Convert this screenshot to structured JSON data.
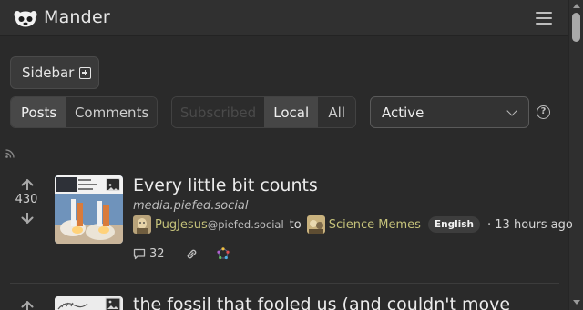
{
  "app": {
    "name": "Mander"
  },
  "toolbar": {
    "sidebar_label": "Sidebar"
  },
  "tabs": {
    "posts": "Posts",
    "comments": "Comments"
  },
  "feed_filter": {
    "subscribed": "Subscribed",
    "local": "Local",
    "all": "All",
    "selected": "Local"
  },
  "sort": {
    "value": "Active"
  },
  "colors": {
    "background": "#2a2a2a",
    "topbar": "#303030",
    "link": "#c5c27a"
  },
  "posts": [
    {
      "title": "Every little bit counts",
      "domain": "media.piefed.social",
      "score": "430",
      "author": "PugJesus",
      "author_instance": "@piefed.social",
      "connector": "to",
      "community": "Science Memes",
      "language": "English",
      "time": "13 hours ago",
      "comments": "32"
    },
    {
      "title": "the fossil that fooled us (and couldn't move"
    }
  ]
}
